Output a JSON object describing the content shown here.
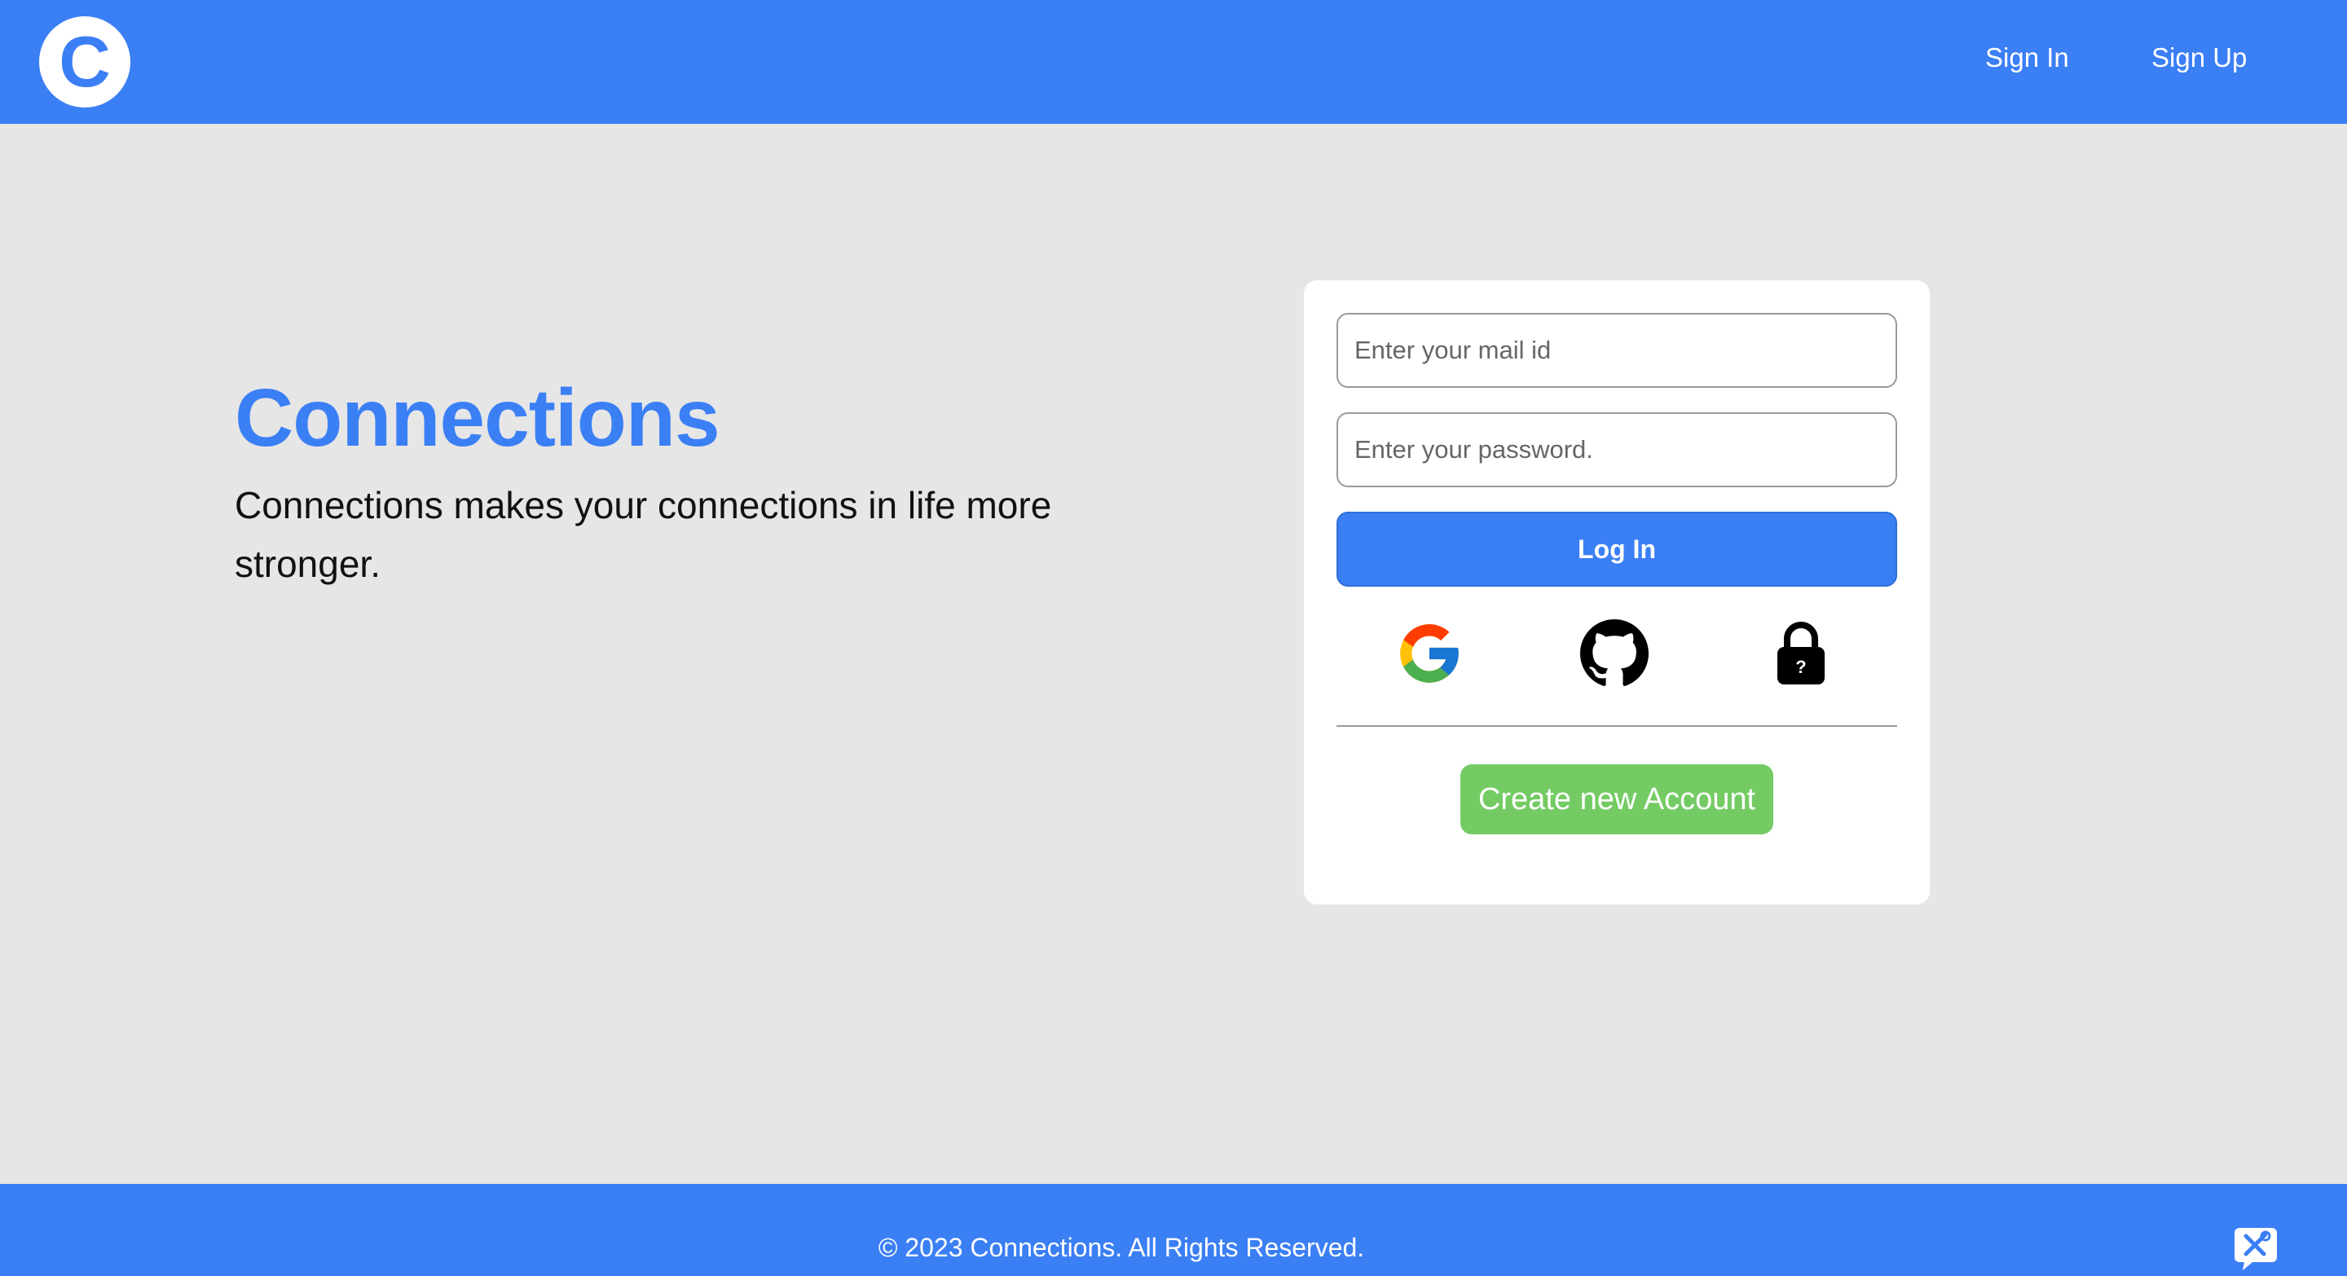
{
  "header": {
    "logo_letter": "C",
    "nav": {
      "sign_in": "Sign In",
      "sign_up": "Sign Up"
    }
  },
  "hero": {
    "title": "Connections",
    "tagline": "Connections makes your connections in life more stronger."
  },
  "login_card": {
    "email_placeholder": "Enter your mail id",
    "password_placeholder": "Enter your password.",
    "login_label": "Log In",
    "social_icons": [
      "google-icon",
      "github-icon",
      "lock-icon"
    ],
    "create_account_label": "Create new Account"
  },
  "footer": {
    "copyright": "© 2023 Connections. All Rights Reserved."
  },
  "colors": {
    "brand": "#3b7ff5",
    "background": "#e6e6e6",
    "create_account": "#74cb64"
  }
}
